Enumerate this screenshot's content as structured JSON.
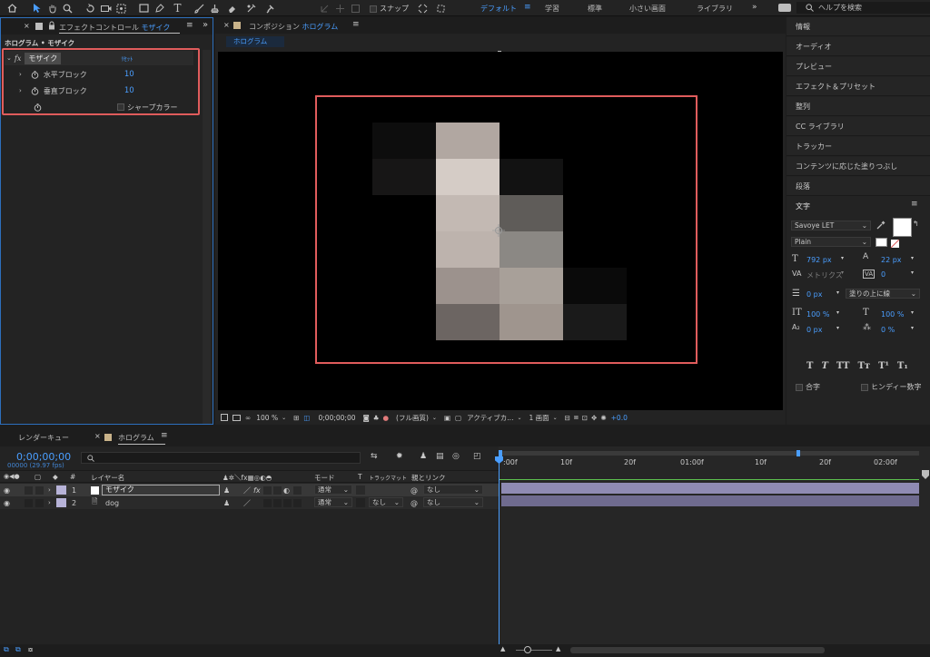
{
  "toolbar": {
    "snap_label": "スナップ",
    "workspaces": [
      "デフォルト",
      "学習",
      "標準",
      "小さい画面",
      "ライブラリ"
    ],
    "search_placeholder": "ヘルプを検索"
  },
  "effect_controls": {
    "tab_prefix": "エフェクトコントロール",
    "tab_layer": "モザイク",
    "breadcrumb": "ホログラム • モザイク",
    "fx_label": "fx",
    "effect_name": "モザイク",
    "reset_label": "ﾘｾｯﾄ",
    "params": [
      {
        "label": "水平ブロック",
        "value": "10"
      },
      {
        "label": "垂直ブロック",
        "value": "10"
      }
    ],
    "sharp_colors_label": "シャープカラー"
  },
  "composition": {
    "tab_prefix": "コンポジション",
    "tab_name": "ホログラム",
    "subtab": "ホログラム",
    "zoom": "100 %",
    "timecode": "0;00;00;00",
    "resolution": "(フル画質)",
    "camera": "アクティブカ...",
    "views": "1 画面",
    "exposure": "+0.0"
  },
  "right_panel": {
    "items": [
      "情報",
      "オーディオ",
      "プレビュー",
      "エフェクト＆プリセット",
      "整列",
      "CC ライブラリ",
      "トラッカー",
      "コンテンツに応じた塗りつぶし",
      "段落"
    ],
    "character_title": "文字",
    "font_family": "Savoye LET",
    "font_style": "Plain",
    "font_size": "792 px",
    "leading": "22 px",
    "kerning": "メトリクス",
    "tracking": "0",
    "stroke_width": "0 px",
    "stroke_type": "塗りの上に線",
    "vert_scale": "100 %",
    "horiz_scale": "100 %",
    "baseline": "0 px",
    "tsume": "0 %",
    "ligature_label": "合字",
    "hindi_label": "ヒンディー数字"
  },
  "timeline": {
    "render_queue_tab": "レンダーキュー",
    "comp_tab": "ホログラム",
    "timecode": "0;00;00;00",
    "frame_info": "00000 (29.97 fps)",
    "col_layer_name": "レイヤー名",
    "col_mode": "モード",
    "col_t": "T",
    "col_trackmatte": "トラックマット",
    "col_parent": "親とリンク",
    "col_num": "#",
    "ruler": [
      ":00f",
      "10f",
      "20f",
      "01:00f",
      "10f",
      "20f",
      "02:00f"
    ],
    "layers": [
      {
        "num": "1",
        "name": "モザイク",
        "mode": "通常",
        "trackmatte": "",
        "parent": "なし"
      },
      {
        "num": "2",
        "name": "dog",
        "mode": "通常",
        "trackmatte": "なし",
        "parent": "なし"
      }
    ]
  },
  "mosaic_cells": [
    {
      "col": 0,
      "row": 0,
      "color": "#0d0d0d"
    },
    {
      "col": 1,
      "row": 0,
      "color": "#b1a7a1"
    },
    {
      "col": 0,
      "row": 1,
      "color": "#171616"
    },
    {
      "col": 1,
      "row": 1,
      "color": "#d5ccc6"
    },
    {
      "col": 2,
      "row": 1,
      "color": "#121212"
    },
    {
      "col": 1,
      "row": 2,
      "color": "#c3b9b3"
    },
    {
      "col": 2,
      "row": 2,
      "color": "#5f5c59"
    },
    {
      "col": 1,
      "row": 3,
      "color": "#bdb3ad"
    },
    {
      "col": 2,
      "row": 3,
      "color": "#8b8884"
    },
    {
      "col": 1,
      "row": 4,
      "color": "#9c928d"
    },
    {
      "col": 2,
      "row": 4,
      "color": "#a8a099"
    },
    {
      "col": 3,
      "row": 4,
      "color": "#0a0a0a"
    },
    {
      "col": 1,
      "row": 5,
      "color": "#6c6562"
    },
    {
      "col": 2,
      "row": 5,
      "color": "#9f958e"
    },
    {
      "col": 3,
      "row": 5,
      "color": "#1a1a1a"
    }
  ],
  "colors": {
    "accent": "#4a9eff",
    "highlight_box": "#e05c5c",
    "layer_color": "#b7b3d8"
  }
}
